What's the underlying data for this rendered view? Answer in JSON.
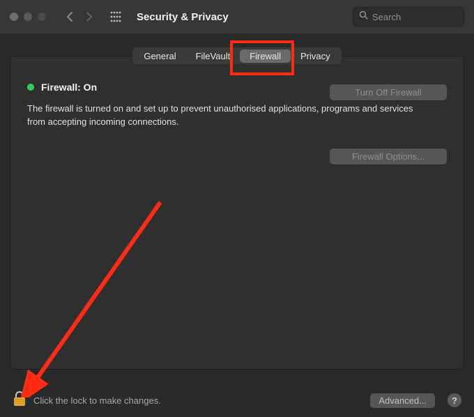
{
  "header": {
    "title": "Security & Privacy",
    "search_placeholder": "Search"
  },
  "tabs": {
    "general": "General",
    "filevault": "FileVault",
    "firewall": "Firewall",
    "privacy": "Privacy"
  },
  "firewall": {
    "status_label": "Firewall: On",
    "status_color": "#30d158",
    "description": "The firewall is turned on and set up to prevent unauthorised applications, programs and services from accepting incoming connections.",
    "turn_off_label": "Turn Off Firewall",
    "options_label": "Firewall Options..."
  },
  "footer": {
    "lock_text": "Click the lock to make changes.",
    "advanced_label": "Advanced...",
    "help_label": "?"
  },
  "annotation": {
    "highlight_target": "firewall-tab",
    "arrow_target": "lock-icon",
    "arrow_color": "#ff2b12"
  }
}
